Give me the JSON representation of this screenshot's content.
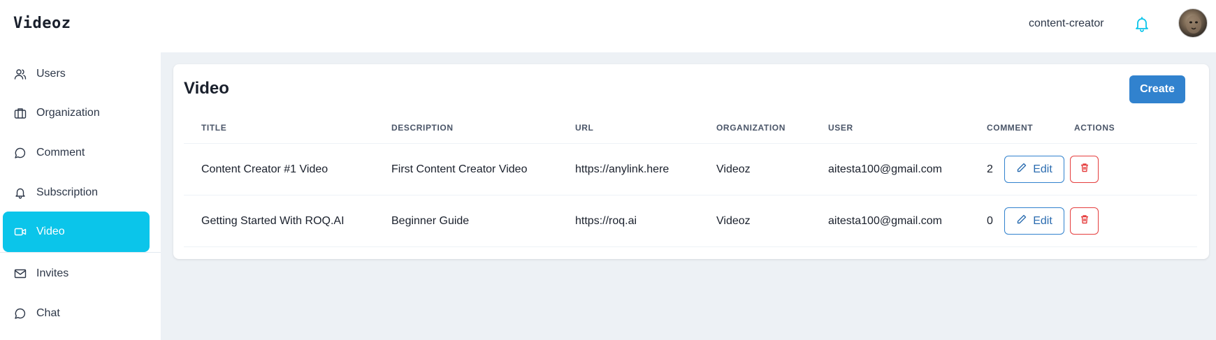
{
  "app": {
    "title": "Videoz"
  },
  "header": {
    "role": "content-creator",
    "icons": [
      "bell-icon",
      "avatar"
    ]
  },
  "colors": {
    "accent": "#0bc5ea",
    "primary": "#3182ce",
    "danger": "#e53e3e",
    "background": "#edf1f5"
  },
  "sidebar": {
    "items": [
      {
        "label": "Users",
        "icon": "users-icon",
        "active": false
      },
      {
        "label": "Organization",
        "icon": "briefcase-icon",
        "active": false
      },
      {
        "label": "Comment",
        "icon": "chat-bubble-icon",
        "active": false
      },
      {
        "label": "Subscription",
        "icon": "bell-icon",
        "active": false
      },
      {
        "label": "Video",
        "icon": "video-icon",
        "active": true
      },
      {
        "label": "Invites",
        "icon": "mail-icon",
        "active": false
      },
      {
        "label": "Chat",
        "icon": "chat-bubble-icon",
        "active": false
      }
    ]
  },
  "main": {
    "title": "Video",
    "create_label": "Create",
    "table": {
      "headers": [
        "TITLE",
        "DESCRIPTION",
        "URL",
        "ORGANIZATION",
        "USER",
        "COMMENT",
        "ACTIONS"
      ],
      "rows": [
        {
          "title": "Content Creator #1 Video",
          "description": "First Content Creator Video",
          "url": "https://anylink.here",
          "organization": "Videoz",
          "user": "aitesta100@gmail.com",
          "comment": "2",
          "edit_label": "Edit"
        },
        {
          "title": "Getting Started With ROQ.AI",
          "description": "Beginner Guide",
          "url": "https://roq.ai",
          "organization": "Videoz",
          "user": "aitesta100@gmail.com",
          "comment": "0",
          "edit_label": "Edit"
        }
      ]
    }
  }
}
